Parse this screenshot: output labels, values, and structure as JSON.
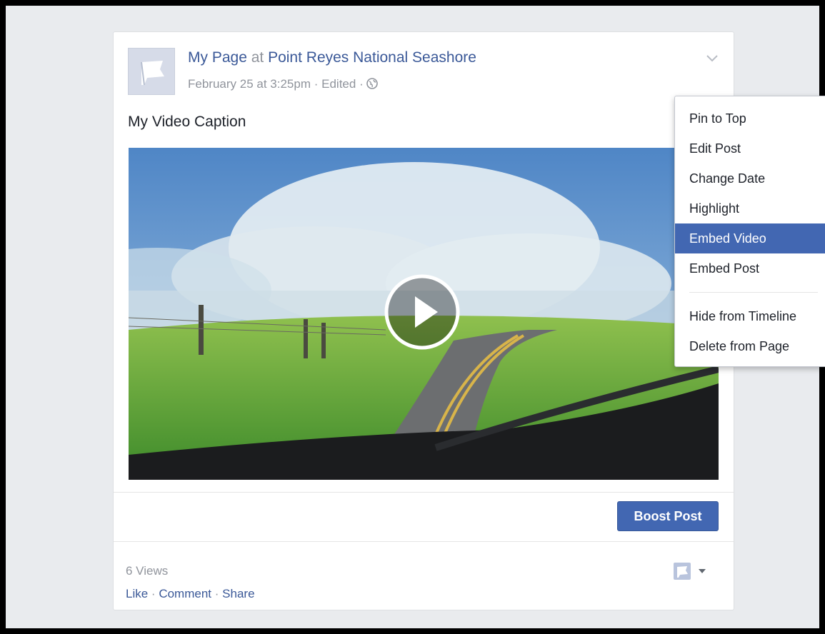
{
  "post": {
    "page_name": "My Page",
    "at_text": "at",
    "location": "Point Reyes National Seashore",
    "date": "February 25 at 3:25pm",
    "separator": "·",
    "edited": "Edited",
    "caption": "My Video Caption",
    "views": "6 Views"
  },
  "actions": {
    "like": "Like",
    "comment": "Comment",
    "share": "Share",
    "separator": "·"
  },
  "boost_label": "Boost Post",
  "menu": {
    "items": [
      {
        "label": "Pin to Top"
      },
      {
        "label": "Edit Post"
      },
      {
        "label": "Change Date"
      },
      {
        "label": "Highlight"
      },
      {
        "label": "Embed Video",
        "active": true
      },
      {
        "label": "Embed Post"
      }
    ],
    "items_after_separator": [
      {
        "label": "Hide from Timeline"
      },
      {
        "label": "Delete from Page"
      }
    ]
  },
  "icons": {
    "avatar": "flag-icon",
    "privacy": "globe-icon",
    "post_options": "chevron-down-icon",
    "play": "play-icon",
    "page_selector": "flag-icon"
  },
  "colors": {
    "brand_blue": "#4267b2",
    "link_blue": "#3b5998",
    "meta_gray": "#90949c",
    "background": "#e9ebee"
  }
}
